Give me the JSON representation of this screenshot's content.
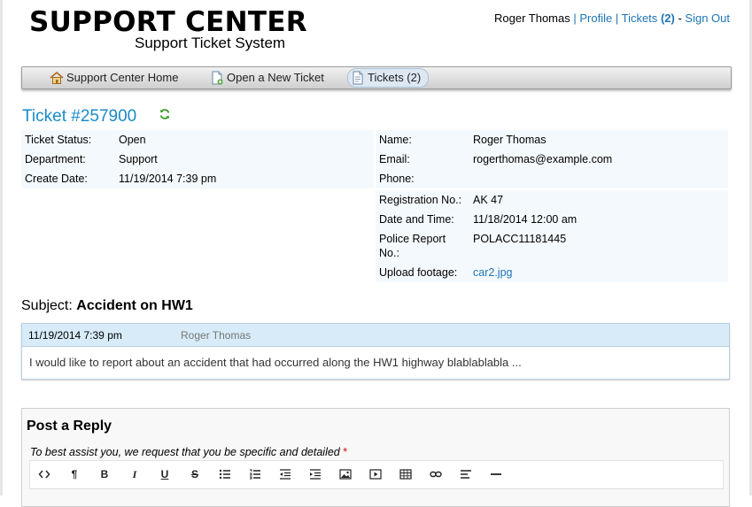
{
  "header": {
    "logo_title": "SUPPORT CENTER",
    "logo_subtitle": "Support Ticket System",
    "user_name": "Roger Thomas",
    "profile_link": "Profile",
    "tickets_link": "Tickets",
    "tickets_count": "(2)",
    "signout_link": "Sign Out"
  },
  "nav": {
    "home": "Support Center Home",
    "new_ticket": "Open a New Ticket",
    "tickets": "Tickets (2)"
  },
  "ticket": {
    "title": "Ticket #257900",
    "left": [
      {
        "label": "Ticket Status:",
        "value": "Open"
      },
      {
        "label": "Department:",
        "value": "Support"
      },
      {
        "label": "Create Date:",
        "value": "11/19/2014 7:39 pm"
      }
    ],
    "contact": [
      {
        "label": "Name:",
        "value": "Roger Thomas"
      },
      {
        "label": "Email:",
        "value": "rogerthomas@example.com"
      },
      {
        "label": "Phone:",
        "value": ""
      }
    ],
    "extra": [
      {
        "label": "Registration No.:",
        "value": "AK 47"
      },
      {
        "label": "Date and Time:",
        "value": "11/18/2014 12:00 am"
      },
      {
        "label_line1": "Police Report",
        "label_line2": "No.:",
        "value": "POLACC11181445"
      },
      {
        "label": "Upload footage:",
        "value": "car2.jpg"
      }
    ]
  },
  "subject": {
    "label": "Subject:",
    "value": "Accident on HW1"
  },
  "thread": {
    "date": "11/19/2014 7:39 pm",
    "author": "Roger Thomas",
    "body": "I would like to report about an accident that had occurred along the HW1 highway blablablabla ..."
  },
  "reply": {
    "title": "Post a Reply",
    "hint": "To best assist you, we request that you be specific and detailed",
    "required_mark": "*"
  },
  "colors": {
    "link": "#1e74b5",
    "ticket_title": "#1b8ac8",
    "info_bg": "#f4f9fd",
    "thread_head_bg": "#d7ebf8"
  }
}
